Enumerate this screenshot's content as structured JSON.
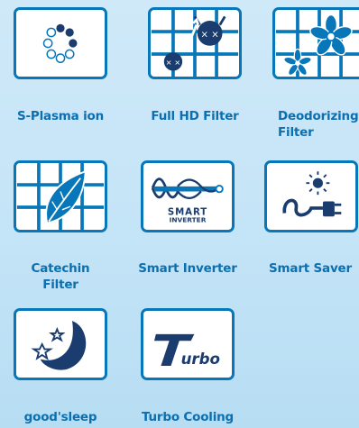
{
  "features": [
    {
      "id": "s-plasma-ion",
      "label": "S-Plasma ion",
      "icon": "plasma-dots-icon"
    },
    {
      "id": "full-hd-filter",
      "label": "Full HD Filter",
      "icon": "filter-bacteria-icon"
    },
    {
      "id": "deodorizing-filter",
      "label": "Deodorizing Filter",
      "icon": "filter-flowers-icon"
    },
    {
      "id": "catechin-filter",
      "label": "Catechin Filter",
      "icon": "filter-leaf-icon"
    },
    {
      "id": "smart-inverter",
      "label": "Smart Inverter",
      "icon": "inverter-wave-icon",
      "badge": [
        "SMART",
        "INVERTER"
      ]
    },
    {
      "id": "smart-saver",
      "label": "Smart Saver",
      "icon": "plug-sun-icon"
    },
    {
      "id": "good-sleep",
      "label": "good'sleep",
      "icon": "moon-stars-icon"
    },
    {
      "id": "turbo-cooling",
      "label": "Turbo Cooling",
      "icon": "turbo-logo-icon",
      "logo_text": "urbo"
    }
  ],
  "colors": {
    "accent": "#0877ba",
    "label": "#0b6fb0",
    "background": "#c8e6f7"
  }
}
